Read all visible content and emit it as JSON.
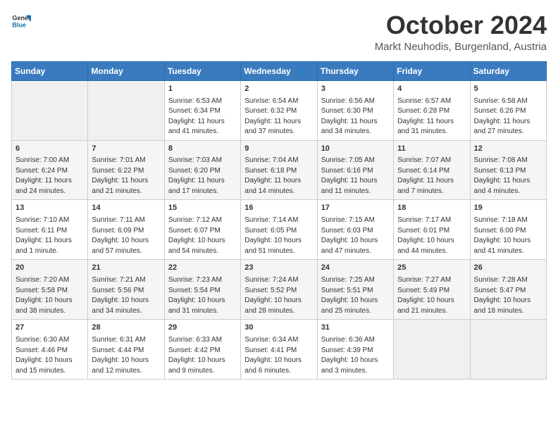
{
  "header": {
    "logo": {
      "general": "General",
      "blue": "Blue"
    },
    "title": "October 2024",
    "location": "Markt Neuhodis, Burgenland, Austria"
  },
  "calendar": {
    "days_of_week": [
      "Sunday",
      "Monday",
      "Tuesday",
      "Wednesday",
      "Thursday",
      "Friday",
      "Saturday"
    ],
    "weeks": [
      [
        {
          "day": "",
          "empty": true
        },
        {
          "day": "",
          "empty": true
        },
        {
          "day": "1",
          "sunrise": "6:53 AM",
          "sunset": "6:34 PM",
          "daylight": "11 hours and 41 minutes."
        },
        {
          "day": "2",
          "sunrise": "6:54 AM",
          "sunset": "6:32 PM",
          "daylight": "11 hours and 37 minutes."
        },
        {
          "day": "3",
          "sunrise": "6:56 AM",
          "sunset": "6:30 PM",
          "daylight": "11 hours and 34 minutes."
        },
        {
          "day": "4",
          "sunrise": "6:57 AM",
          "sunset": "6:28 PM",
          "daylight": "11 hours and 31 minutes."
        },
        {
          "day": "5",
          "sunrise": "6:58 AM",
          "sunset": "6:26 PM",
          "daylight": "11 hours and 27 minutes."
        }
      ],
      [
        {
          "day": "6",
          "sunrise": "7:00 AM",
          "sunset": "6:24 PM",
          "daylight": "11 hours and 24 minutes."
        },
        {
          "day": "7",
          "sunrise": "7:01 AM",
          "sunset": "6:22 PM",
          "daylight": "11 hours and 21 minutes."
        },
        {
          "day": "8",
          "sunrise": "7:03 AM",
          "sunset": "6:20 PM",
          "daylight": "11 hours and 17 minutes."
        },
        {
          "day": "9",
          "sunrise": "7:04 AM",
          "sunset": "6:18 PM",
          "daylight": "11 hours and 14 minutes."
        },
        {
          "day": "10",
          "sunrise": "7:05 AM",
          "sunset": "6:16 PM",
          "daylight": "11 hours and 11 minutes."
        },
        {
          "day": "11",
          "sunrise": "7:07 AM",
          "sunset": "6:14 PM",
          "daylight": "11 hours and 7 minutes."
        },
        {
          "day": "12",
          "sunrise": "7:08 AM",
          "sunset": "6:13 PM",
          "daylight": "11 hours and 4 minutes."
        }
      ],
      [
        {
          "day": "13",
          "sunrise": "7:10 AM",
          "sunset": "6:11 PM",
          "daylight": "11 hours and 1 minute."
        },
        {
          "day": "14",
          "sunrise": "7:11 AM",
          "sunset": "6:09 PM",
          "daylight": "10 hours and 57 minutes."
        },
        {
          "day": "15",
          "sunrise": "7:12 AM",
          "sunset": "6:07 PM",
          "daylight": "10 hours and 54 minutes."
        },
        {
          "day": "16",
          "sunrise": "7:14 AM",
          "sunset": "6:05 PM",
          "daylight": "10 hours and 51 minutes."
        },
        {
          "day": "17",
          "sunrise": "7:15 AM",
          "sunset": "6:03 PM",
          "daylight": "10 hours and 47 minutes."
        },
        {
          "day": "18",
          "sunrise": "7:17 AM",
          "sunset": "6:01 PM",
          "daylight": "10 hours and 44 minutes."
        },
        {
          "day": "19",
          "sunrise": "7:18 AM",
          "sunset": "6:00 PM",
          "daylight": "10 hours and 41 minutes."
        }
      ],
      [
        {
          "day": "20",
          "sunrise": "7:20 AM",
          "sunset": "5:58 PM",
          "daylight": "10 hours and 38 minutes."
        },
        {
          "day": "21",
          "sunrise": "7:21 AM",
          "sunset": "5:56 PM",
          "daylight": "10 hours and 34 minutes."
        },
        {
          "day": "22",
          "sunrise": "7:23 AM",
          "sunset": "5:54 PM",
          "daylight": "10 hours and 31 minutes."
        },
        {
          "day": "23",
          "sunrise": "7:24 AM",
          "sunset": "5:52 PM",
          "daylight": "10 hours and 28 minutes."
        },
        {
          "day": "24",
          "sunrise": "7:25 AM",
          "sunset": "5:51 PM",
          "daylight": "10 hours and 25 minutes."
        },
        {
          "day": "25",
          "sunrise": "7:27 AM",
          "sunset": "5:49 PM",
          "daylight": "10 hours and 21 minutes."
        },
        {
          "day": "26",
          "sunrise": "7:28 AM",
          "sunset": "5:47 PM",
          "daylight": "10 hours and 18 minutes."
        }
      ],
      [
        {
          "day": "27",
          "sunrise": "6:30 AM",
          "sunset": "4:46 PM",
          "daylight": "10 hours and 15 minutes."
        },
        {
          "day": "28",
          "sunrise": "6:31 AM",
          "sunset": "4:44 PM",
          "daylight": "10 hours and 12 minutes."
        },
        {
          "day": "29",
          "sunrise": "6:33 AM",
          "sunset": "4:42 PM",
          "daylight": "10 hours and 9 minutes."
        },
        {
          "day": "30",
          "sunrise": "6:34 AM",
          "sunset": "4:41 PM",
          "daylight": "10 hours and 6 minutes."
        },
        {
          "day": "31",
          "sunrise": "6:36 AM",
          "sunset": "4:39 PM",
          "daylight": "10 hours and 3 minutes."
        },
        {
          "day": "",
          "empty": true
        },
        {
          "day": "",
          "empty": true
        }
      ]
    ]
  }
}
